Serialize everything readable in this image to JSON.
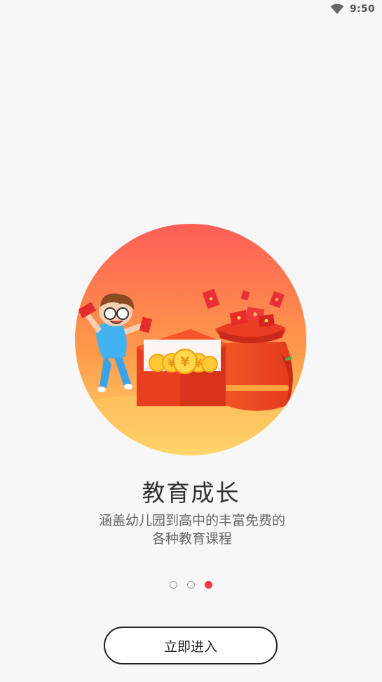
{
  "status_bar": {
    "time": "9:50",
    "wifi_icon": "wifi-icon"
  },
  "onboarding": {
    "illustration": "red-envelope-coins-illustration",
    "coin_symbol": "¥",
    "title": "教育成长",
    "description": "涵盖幼儿园到高中的丰富免费的各种教育课程",
    "page_count": 3,
    "active_page": 3,
    "enter_button_label": "立即进入"
  },
  "colors": {
    "accent": "#f0384d",
    "background": "#f7f7f7",
    "title_text": "#333333",
    "description_text": "#666666"
  }
}
